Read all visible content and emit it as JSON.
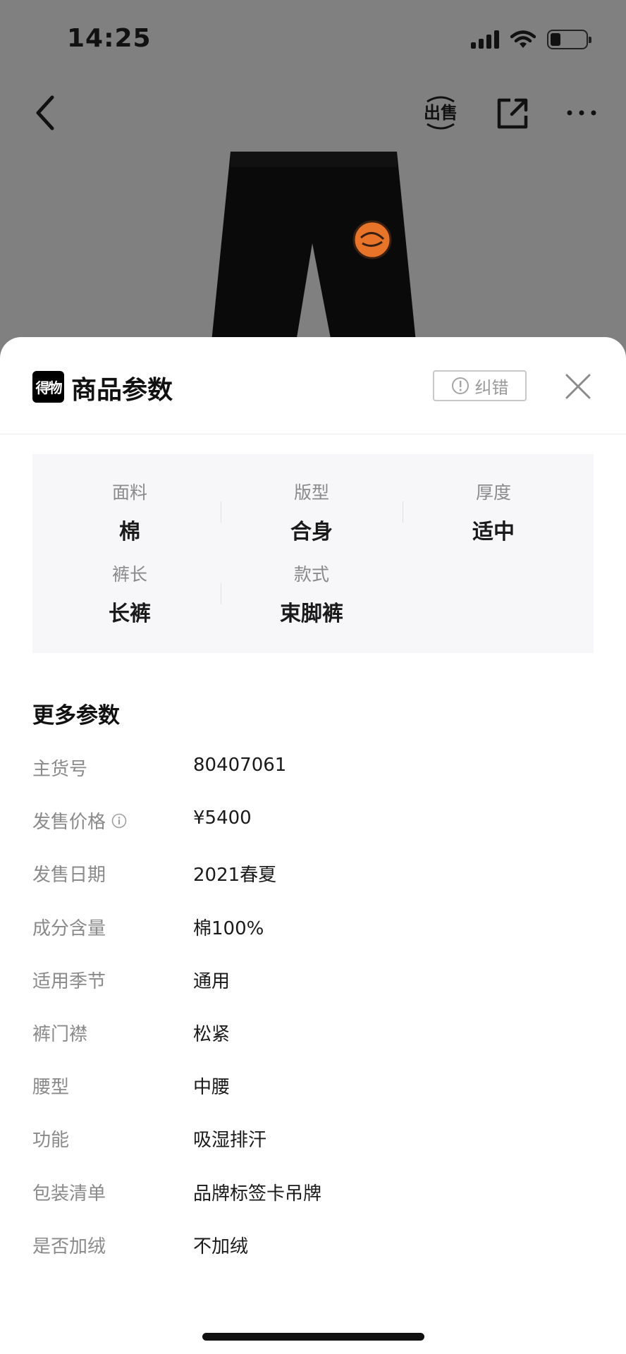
{
  "status_bar": {
    "time": "14:25"
  },
  "nav": {
    "sell_label": "出售"
  },
  "sheet": {
    "brand_logo_text": "得物",
    "title": "商品参数",
    "report_label": "纠错"
  },
  "key_params": [
    {
      "label": "面料",
      "value": "棉"
    },
    {
      "label": "版型",
      "value": "合身"
    },
    {
      "label": "厚度",
      "value": "适中"
    },
    {
      "label": "裤长",
      "value": "长裤"
    },
    {
      "label": "款式",
      "value": "束脚裤"
    }
  ],
  "more_params": {
    "title": "更多参数",
    "rows": [
      {
        "label": "主货号",
        "value": "80407061"
      },
      {
        "label": "发售价格",
        "value": "¥5400"
      },
      {
        "label": "发售日期",
        "value": "2021春夏"
      },
      {
        "label": "成分含量",
        "value": "棉100%"
      },
      {
        "label": "适用季节",
        "value": "通用"
      },
      {
        "label": "裤门襟",
        "value": "松紧"
      },
      {
        "label": "腰型",
        "value": "中腰"
      },
      {
        "label": "功能",
        "value": "吸湿排汗"
      },
      {
        "label": "包装清单",
        "value": "品牌标签卡吊牌"
      },
      {
        "label": "是否加绒",
        "value": "不加绒"
      }
    ]
  },
  "colors": {
    "overlay": "#808080",
    "sheet_bg": "#ffffff",
    "key_params_bg": "#f7f7fa",
    "label_gray": "#8a8a8a",
    "patch_orange": "#e8742a"
  }
}
